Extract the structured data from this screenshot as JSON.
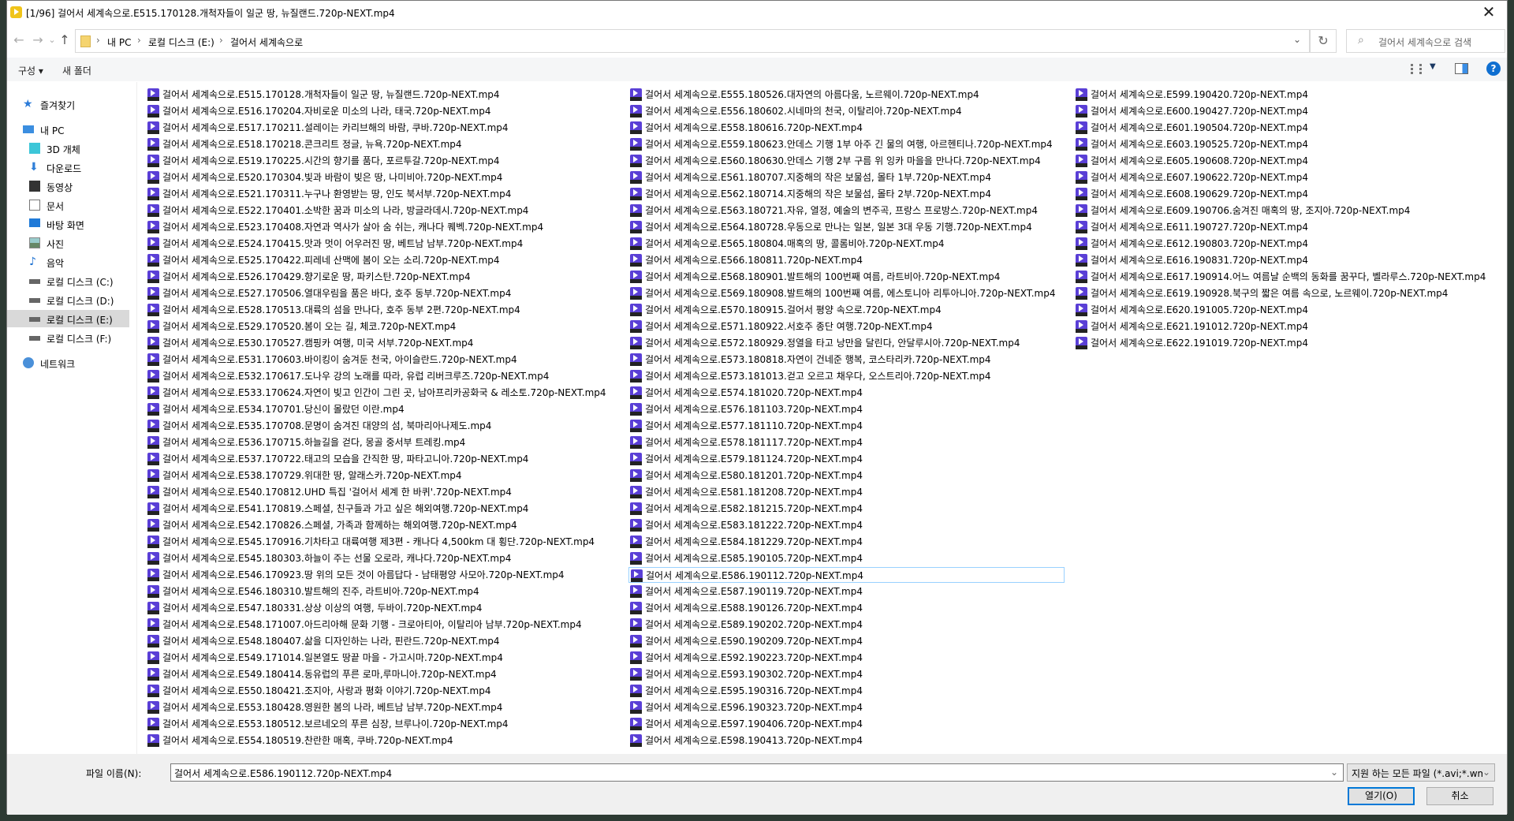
{
  "window": {
    "title": "[1/96] 걸어서 세계속으로.E515.170128.개척자들이 일군 땅, 뉴질랜드.720p-NEXT.mp4",
    "close": "✕"
  },
  "nav": {
    "back": "←",
    "forward": "→",
    "recent": "⌄",
    "up": "↑"
  },
  "address": {
    "crumbs": [
      "내 PC",
      "로컬 디스크 (E:)",
      "걸어서 세계속으로"
    ],
    "separator": "›",
    "dropdown": "⌄",
    "refresh": "↻"
  },
  "search": {
    "placeholder": "걸어서 세계속으로 검색",
    "icon": "⌕"
  },
  "toolbar": {
    "organize": "구성 ▾",
    "new_folder": "새 폴더",
    "view_dd": "▼",
    "help": "?"
  },
  "sidebar": {
    "items": [
      {
        "label": "즐겨찾기",
        "icon": "star"
      },
      {
        "label": "내 PC",
        "icon": "pc"
      },
      {
        "label": "3D 개체",
        "icon": "cube"
      },
      {
        "label": "다운로드",
        "icon": "download"
      },
      {
        "label": "동영상",
        "icon": "film"
      },
      {
        "label": "문서",
        "icon": "document"
      },
      {
        "label": "바탕 화면",
        "icon": "desktop"
      },
      {
        "label": "사진",
        "icon": "picture"
      },
      {
        "label": "음악",
        "icon": "music"
      },
      {
        "label": "로컬 디스크 (C:)",
        "icon": "drive"
      },
      {
        "label": "로컬 디스크 (D:)",
        "icon": "drive"
      },
      {
        "label": "로컬 디스크 (E:)",
        "icon": "drive",
        "selected": true
      },
      {
        "label": "로컬 디스크 (F:)",
        "icon": "drive"
      },
      {
        "label": "네트워크",
        "icon": "network"
      }
    ]
  },
  "files": {
    "columns": [
      [
        "걸어서 세계속으로.E515.170128.개척자들이 일군 땅, 뉴질랜드.720p-NEXT.mp4",
        "걸어서 세계속으로.E516.170204.자비로운 미소의 나라, 태국.720p-NEXT.mp4",
        "걸어서 세계속으로.E517.170211.설레이는 카리브해의 바람, 쿠바.720p-NEXT.mp4",
        "걸어서 세계속으로.E518.170218.콘크리트 정글, 뉴욕.720p-NEXT.mp4",
        "걸어서 세계속으로.E519.170225.시간의 향기를 품다, 포르투갈.720p-NEXT.mp4",
        "걸어서 세계속으로.E520.170304.빛과 바람이 빚은 땅, 나미비아.720p-NEXT.mp4",
        "걸어서 세계속으로.E521.170311.누구나 환영받는 땅, 인도 북서부.720p-NEXT.mp4",
        "걸어서 세계속으로.E522.170401.소박한 꿈과 미소의 나라, 방글라데시.720p-NEXT.mp4",
        "걸어서 세계속으로.E523.170408.자연과 역사가 살아 숨 쉬는, 캐나다 퀘벡.720p-NEXT.mp4",
        "걸어서 세계속으로.E524.170415.맛과 멋이 어우러진 땅, 베트남 남부.720p-NEXT.mp4",
        "걸어서 세계속으로.E525.170422.피레네 산맥에 봄이 오는 소리.720p-NEXT.mp4",
        "걸어서 세계속으로.E526.170429.향기로운 땅, 파키스탄.720p-NEXT.mp4",
        "걸어서 세계속으로.E527.170506.열대우림을 품은 바다, 호주 동부.720p-NEXT.mp4",
        "걸어서 세계속으로.E528.170513.대륙의 섬을 만나다, 호주 동부 2편.720p-NEXT.mp4",
        "걸어서 세계속으로.E529.170520.봄이 오는 길, 체코.720p-NEXT.mp4",
        "걸어서 세계속으로.E530.170527.캠핑카 여행, 미국 서부.720p-NEXT.mp4",
        "걸어서 세계속으로.E531.170603.바이킹이 숨겨둔 천국, 아이슬란드.720p-NEXT.mp4",
        "걸어서 세계속으로.E532.170617.도나우 강의 노래를 따라, 유럽 리버크루즈.720p-NEXT.mp4",
        "걸어서 세계속으로.E533.170624.자연이 빚고 인간이 그린 곳, 남아프리카공화국 & 레소토.720p-NEXT.mp4",
        "걸어서 세계속으로.E534.170701.당신이 몰랐던 이란.mp4",
        "걸어서 세계속으로.E535.170708.문명이 숨겨진 대양의 섬, 북마리아나제도.mp4",
        "걸어서 세계속으로.E536.170715.하늘길을 걷다, 몽골 중서부 트레킹.mp4",
        "걸어서 세계속으로.E537.170722.태고의 모습을 간직한 땅, 파타고니아.720p-NEXT.mp4",
        "걸어서 세계속으로.E538.170729.위대한 땅, 알래스카.720p-NEXT.mp4",
        "걸어서 세계속으로.E540.170812.UHD 특집 '걸어서 세계 한 바퀴'.720p-NEXT.mp4",
        "걸어서 세계속으로.E541.170819.스페셜, 친구들과 가고 싶은 해외여행.720p-NEXT.mp4",
        "걸어서 세계속으로.E542.170826.스페셜, 가족과 함께하는 해외여행.720p-NEXT.mp4",
        "걸어서 세계속으로.E545.170916.기차타고 대륙여행 제3편 - 캐나다 4,500km 대 횡단.720p-NEXT.mp4",
        "걸어서 세계속으로.E545.180303.하늘이 주는 선물 오로라, 캐나다.720p-NEXT.mp4",
        "걸어서 세계속으로.E546.170923.땅 위의 모든 것이 아름답다 - 남태평양 사모아.720p-NEXT.mp4",
        "걸어서 세계속으로.E546.180310.발트해의 진주, 라트비아.720p-NEXT.mp4",
        "걸어서 세계속으로.E547.180331.상상 이상의 여행, 두바이.720p-NEXT.mp4",
        "걸어서 세계속으로.E548.171007.아드리아해 문화 기행 - 크로아티아, 이탈리아 남부.720p-NEXT.mp4",
        "걸어서 세계속으로.E548.180407.삶을 디자인하는 나라, 핀란드.720p-NEXT.mp4",
        "걸어서 세계속으로.E549.171014.일본열도 땅끝 마을 - 가고시마.720p-NEXT.mp4",
        "걸어서 세계속으로.E549.180414.동유럽의 푸른 로마,루마니아.720p-NEXT.mp4",
        "걸어서 세계속으로.E550.180421.조지아, 사랑과 평화 이야기.720p-NEXT.mp4",
        "걸어서 세계속으로.E553.180428.영원한 봄의 나라, 베트남 남부.720p-NEXT.mp4",
        "걸어서 세계속으로.E553.180512.보르네오의 푸른 심장, 브루나이.720p-NEXT.mp4",
        "걸어서 세계속으로.E554.180519.찬란한 매혹, 쿠바.720p-NEXT.mp4"
      ],
      [
        "걸어서 세계속으로.E555.180526.대자연의 아름다움, 노르웨이.720p-NEXT.mp4",
        "걸어서 세계속으로.E556.180602.시네마의 천국, 이탈리아.720p-NEXT.mp4",
        "걸어서 세계속으로.E558.180616.720p-NEXT.mp4",
        "걸어서 세계속으로.E559.180623.안데스 기행 1부 아주 긴 물의 여행, 아르헨티나.720p-NEXT.mp4",
        "걸어서 세계속으로.E560.180630.안데스 기행 2부 구름 위 잉카 마을을 만나다.720p-NEXT.mp4",
        "걸어서 세계속으로.E561.180707.지중해의 작은 보물섬, 몰타 1부.720p-NEXT.mp4",
        "걸어서 세계속으로.E562.180714.지중해의 작은 보물섬, 몰타 2부.720p-NEXT.mp4",
        "걸어서 세계속으로.E563.180721.자유, 열정, 예술의 변주곡, 프랑스 프로방스.720p-NEXT.mp4",
        "걸어서 세계속으로.E564.180728.우동으로 만나는 일본, 일본 3대 우동 기행.720p-NEXT.mp4",
        "걸어서 세계속으로.E565.180804.매혹의 땅, 콜롬비아.720p-NEXT.mp4",
        "걸어서 세계속으로.E566.180811.720p-NEXT.mp4",
        "걸어서 세계속으로.E568.180901.발트해의 100번째 여름, 라트비아.720p-NEXT.mp4",
        "걸어서 세계속으로.E569.180908.발트해의 100번째 여름, 에스토니아 리투아니아.720p-NEXT.mp4",
        "걸어서 세계속으로.E570.180915.걸어서 평양 속으로.720p-NEXT.mp4",
        "걸어서 세계속으로.E571.180922.서호주 종단 여행.720p-NEXT.mp4",
        "걸어서 세계속으로.E572.180929.정열을 타고 낭만을 달린다, 안달루시아.720p-NEXT.mp4",
        "걸어서 세계속으로.E573.180818.자연이 건네준 행복, 코스타리카.720p-NEXT.mp4",
        "걸어서 세계속으로.E573.181013.걷고 오르고 채우다, 오스트리아.720p-NEXT.mp4",
        "걸어서 세계속으로.E574.181020.720p-NEXT.mp4",
        "걸어서 세계속으로.E576.181103.720p-NEXT.mp4",
        "걸어서 세계속으로.E577.181110.720p-NEXT.mp4",
        "걸어서 세계속으로.E578.181117.720p-NEXT.mp4",
        "걸어서 세계속으로.E579.181124.720p-NEXT.mp4",
        "걸어서 세계속으로.E580.181201.720p-NEXT.mp4",
        "걸어서 세계속으로.E581.181208.720p-NEXT.mp4",
        "걸어서 세계속으로.E582.181215.720p-NEXT.mp4",
        "걸어서 세계속으로.E583.181222.720p-NEXT.mp4",
        "걸어서 세계속으로.E584.181229.720p-NEXT.mp4",
        "걸어서 세계속으로.E585.190105.720p-NEXT.mp4",
        "걸어서 세계속으로.E586.190112.720p-NEXT.mp4",
        "걸어서 세계속으로.E587.190119.720p-NEXT.mp4",
        "걸어서 세계속으로.E588.190126.720p-NEXT.mp4",
        "걸어서 세계속으로.E589.190202.720p-NEXT.mp4",
        "걸어서 세계속으로.E590.190209.720p-NEXT.mp4",
        "걸어서 세계속으로.E592.190223.720p-NEXT.mp4",
        "걸어서 세계속으로.E593.190302.720p-NEXT.mp4",
        "걸어서 세계속으로.E595.190316.720p-NEXT.mp4",
        "걸어서 세계속으로.E596.190323.720p-NEXT.mp4",
        "걸어서 세계속으로.E597.190406.720p-NEXT.mp4",
        "걸어서 세계속으로.E598.190413.720p-NEXT.mp4"
      ],
      [
        "걸어서 세계속으로.E599.190420.720p-NEXT.mp4",
        "걸어서 세계속으로.E600.190427.720p-NEXT.mp4",
        "걸어서 세계속으로.E601.190504.720p-NEXT.mp4",
        "걸어서 세계속으로.E603.190525.720p-NEXT.mp4",
        "걸어서 세계속으로.E605.190608.720p-NEXT.mp4",
        "걸어서 세계속으로.E607.190622.720p-NEXT.mp4",
        "걸어서 세계속으로.E608.190629.720p-NEXT.mp4",
        "걸어서 세계속으로.E609.190706.숨겨진 매혹의 땅, 조지아.720p-NEXT.mp4",
        "걸어서 세계속으로.E611.190727.720p-NEXT.mp4",
        "걸어서 세계속으로.E612.190803.720p-NEXT.mp4",
        "걸어서 세계속으로.E616.190831.720p-NEXT.mp4",
        "걸어서 세계속으로.E617.190914.어느 여름날 순백의 동화를 꿈꾸다, 벨라루스.720p-NEXT.mp4",
        "걸어서 세계속으로.E619.190928.북구의 짧은 여름 속으로, 노르웨이.720p-NEXT.mp4",
        "걸어서 세계속으로.E620.191005.720p-NEXT.mp4",
        "걸어서 세계속으로.E621.191012.720p-NEXT.mp4",
        "걸어서 세계속으로.E622.191019.720p-NEXT.mp4"
      ]
    ],
    "selected": "걸어서 세계속으로.E586.190112.720p-NEXT.mp4"
  },
  "footer": {
    "filename_label": "파일 이름(N):",
    "filename_value": "걸어서 세계속으로.E586.190112.720p-NEXT.mp4",
    "filter": "지원 하는 모든 파일 (*.avi;*.wm",
    "dd": "⌄",
    "open": "열기(O)",
    "cancel": "취소"
  }
}
